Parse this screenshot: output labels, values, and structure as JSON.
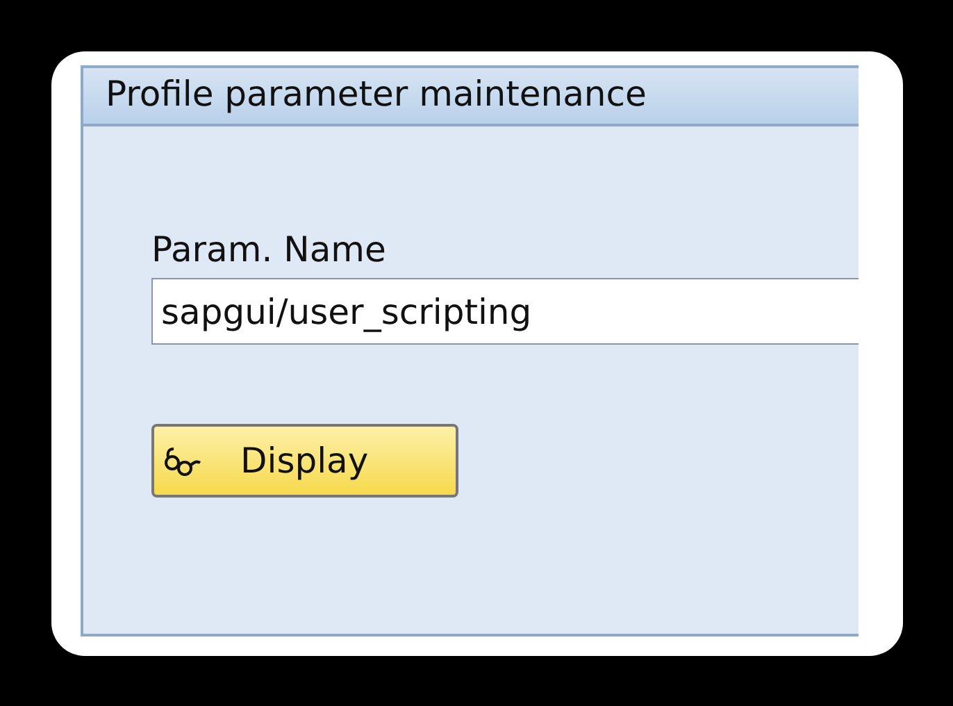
{
  "window": {
    "title": "Profile parameter maintenance"
  },
  "param_field": {
    "label": "Param. Name",
    "value": "sapgui/user_scripting"
  },
  "buttons": [
    {
      "label": "Display"
    }
  ]
}
